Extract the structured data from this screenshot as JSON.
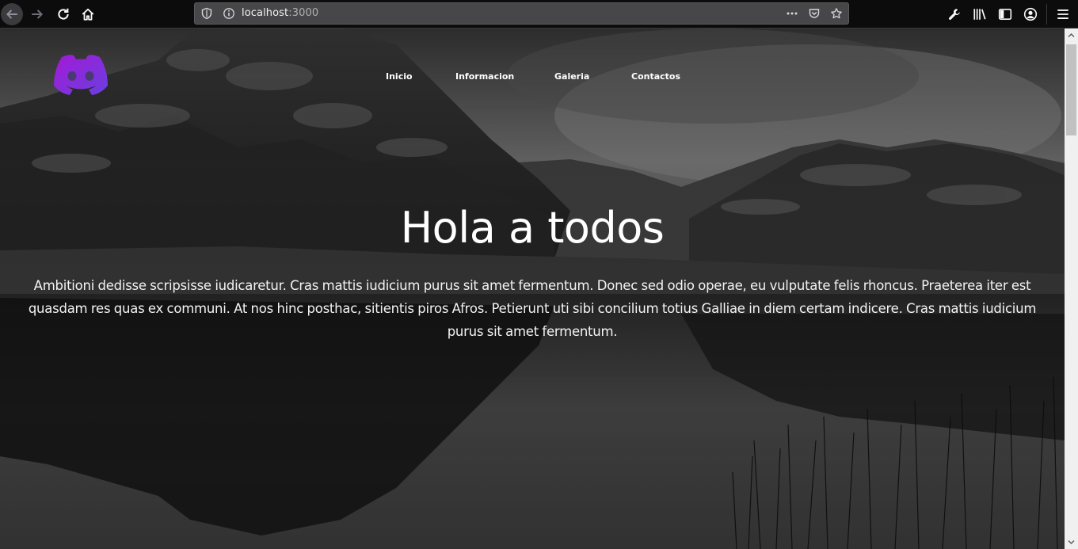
{
  "browser": {
    "url_host": "localhost",
    "url_port": ":3000",
    "icons": [
      "back-arrow-icon",
      "forward-arrow-icon",
      "reload-icon",
      "home-icon",
      "shield-icon",
      "info-icon",
      "more-dots-icon",
      "pocket-icon",
      "star-icon",
      "wrench-icon",
      "library-icon",
      "sidebar-icon",
      "account-icon",
      "menu-icon"
    ]
  },
  "page": {
    "logo": "discord-logo",
    "nav": [
      "Inicio",
      "Informacion",
      "Galeria",
      "Contactos"
    ],
    "hero_title": "Hola a todos",
    "hero_text": "Ambitioni dedisse scripsisse iudicaretur. Cras mattis iudicium purus sit amet fermentum. Donec sed odio operae, eu vulputate felis rhoncus. Praeterea iter est quasdam res quas ex communi. At nos hinc posthac, sitientis piros Afros. Petierunt uti sibi concilium totius Galliae in diem certam indicere. Cras mattis iudicium purus sit amet fermentum."
  },
  "colors": {
    "logo_gradient_start": "#8a2be2",
    "logo_gradient_end": "#7b3fe4",
    "chrome_bg": "#0c0c0d",
    "urlbar_bg": "#474749"
  }
}
